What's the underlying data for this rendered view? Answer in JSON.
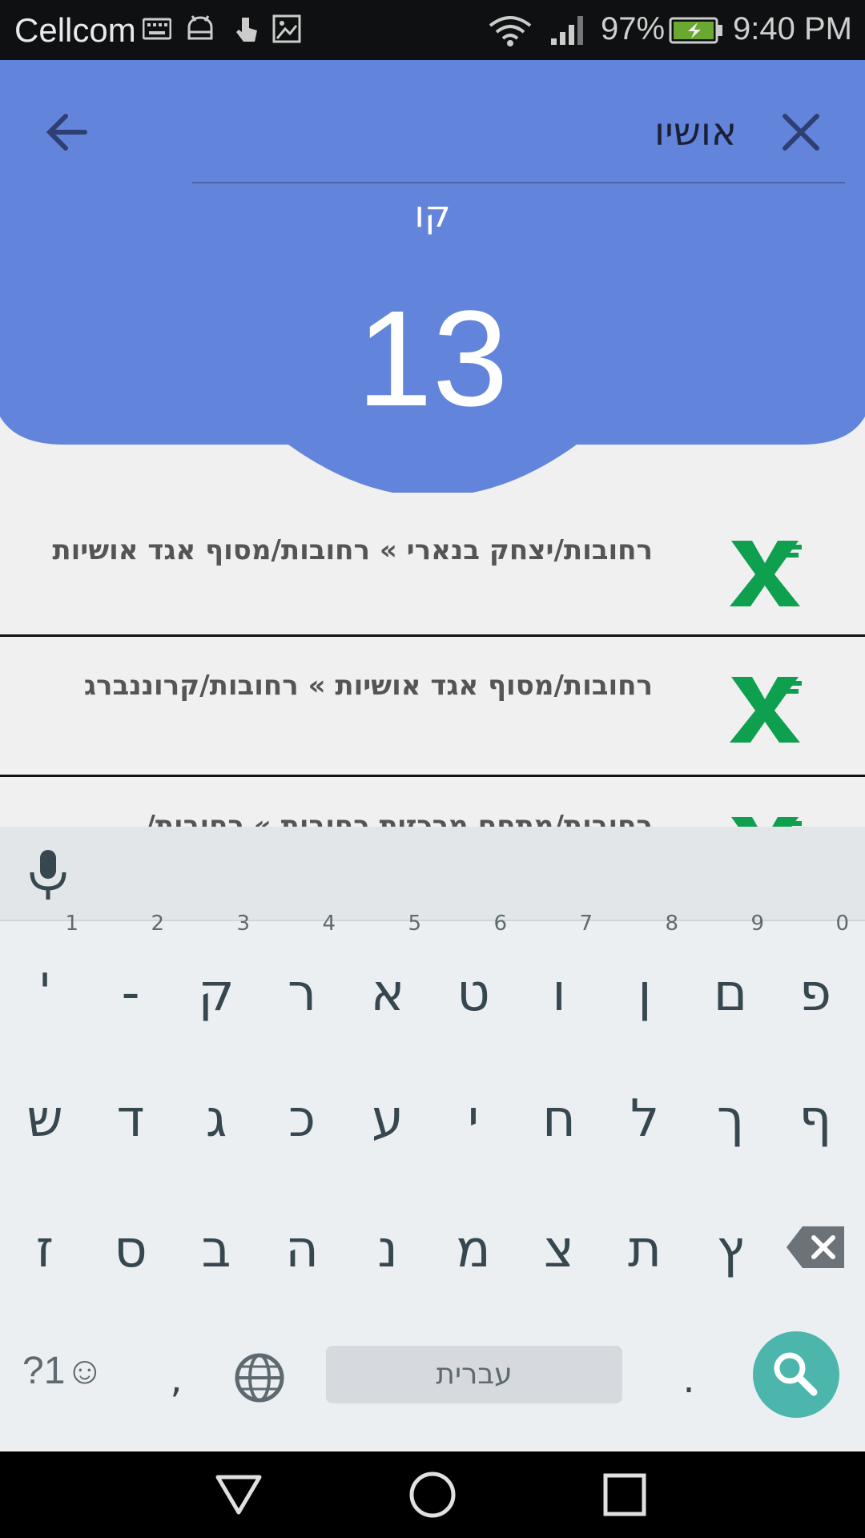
{
  "status_bar": {
    "carrier": "Cellcom",
    "battery": "97%",
    "time": "9:40 PM"
  },
  "header": {
    "search_value": "אושיו",
    "line_label": "קו",
    "line_number": "13",
    "accent_color": "#6284db"
  },
  "routes": [
    {
      "text": "רחובות/יצחק בנארי » רחובות/מסוף אגד אושיות"
    },
    {
      "text": "רחובות/מסוף אגד אושיות » רחובות/קרוננברג"
    },
    {
      "text": "רחובות/מתחם מרכזית רחובות » רחובות/"
    }
  ],
  "keyboard": {
    "row1": [
      {
        "label": "פ",
        "hint": "0"
      },
      {
        "label": "ם",
        "hint": "9"
      },
      {
        "label": "ן",
        "hint": "8"
      },
      {
        "label": "ו",
        "hint": "7"
      },
      {
        "label": "ט",
        "hint": "6"
      },
      {
        "label": "א",
        "hint": "5"
      },
      {
        "label": "ר",
        "hint": "4"
      },
      {
        "label": "ק",
        "hint": "3"
      },
      {
        "label": "-",
        "hint": "2"
      },
      {
        "label": "'",
        "hint": "1"
      }
    ],
    "row2": [
      "ף",
      "ך",
      "ל",
      "ח",
      "י",
      "ע",
      "כ",
      "ג",
      "ד",
      "ש"
    ],
    "row3": [
      "ץ",
      "ת",
      "צ",
      "מ",
      "נ",
      "ה",
      "ב",
      "ס",
      "ז"
    ],
    "symbols_label": "?1☺",
    "comma": ",",
    "space_label": "עברית",
    "period": "."
  }
}
